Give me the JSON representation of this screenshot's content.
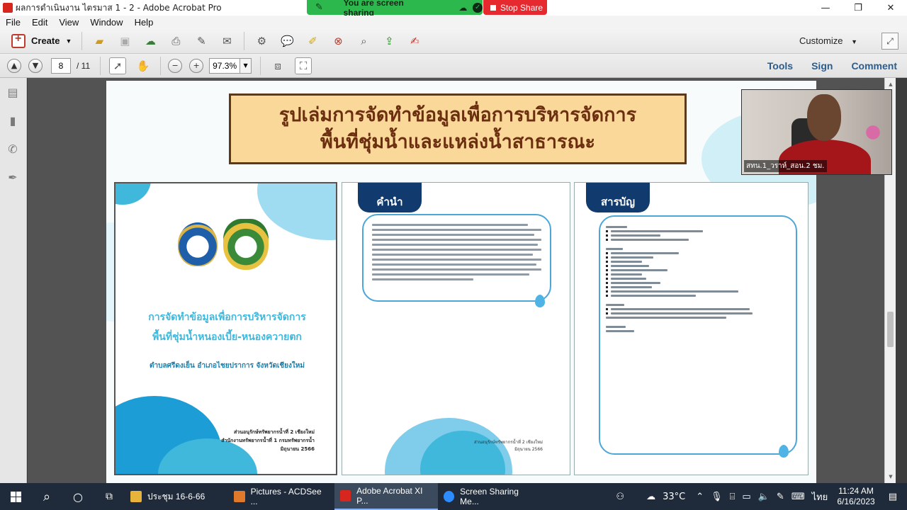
{
  "window": {
    "title": "ผลการดำเนินงาน ไตรมาส 1 - 2 - Adobe Acrobat Pro",
    "controls": [
      "—",
      "❐",
      "✕"
    ]
  },
  "screen_share": {
    "status": "You are screen sharing",
    "stop_label": "Stop Share"
  },
  "menu": [
    "File",
    "Edit",
    "View",
    "Window",
    "Help"
  ],
  "toolbar": {
    "create_label": "Create",
    "customize_label": "Customize"
  },
  "nav": {
    "page_value": "8",
    "page_total": "/ 11",
    "zoom_value": "97.3%"
  },
  "right_tabs": [
    "Tools",
    "Sign",
    "Comment"
  ],
  "document": {
    "banner_line1": "รูปเล่มการจัดทำข้อมูลเพื่อการบริหารจัดการ",
    "banner_line2": "พื้นที่ชุ่มน้ำและแหล่งน้ำสาธารณะ",
    "cover": {
      "title_line1": "การจัดทำข้อมูลเพื่อการบริหารจัดการ",
      "title_line2": "พื้นที่ชุ่มน้ำหนองเบี้ย-หนองควายตก",
      "subtitle": "ตำบลศรีดงเย็น อำเภอไชยปราการ จังหวัดเชียงใหม่",
      "footer_line1": "ส่วนอนุรักษ์ทรัพยากรน้ำที่ 2 เชียงใหม่",
      "footer_line2": "สำนักงานทรัพยากรน้ำที่ 1 กรมทรัพยากรน้ำ",
      "footer_line3": "มิถุนายน 2566"
    },
    "preface": {
      "heading": "คำนำ",
      "footer_line1": "ส่วนอนุรักษ์ทรัพยากรน้ำที่ 2 เชียงใหม่",
      "footer_line2": "มิถุนายน 2566"
    },
    "toc": {
      "heading": "สารบัญ"
    }
  },
  "webcam": {
    "label": "สทน.1_วราห์_สอน.2 ชม."
  },
  "taskbar": {
    "items": [
      {
        "label": "ประชุม 16-6-66",
        "color": "#e8b33a"
      },
      {
        "label": "Pictures - ACDSee ...",
        "color": "#e0792a"
      },
      {
        "label": "Adobe Acrobat XI P...",
        "color": "#d7261e"
      },
      {
        "label": "Screen Sharing Me...",
        "color": "#2d8cff"
      }
    ],
    "temperature": "33°C",
    "language": "ไทย",
    "time": "11:24 AM",
    "date": "6/16/2023"
  }
}
